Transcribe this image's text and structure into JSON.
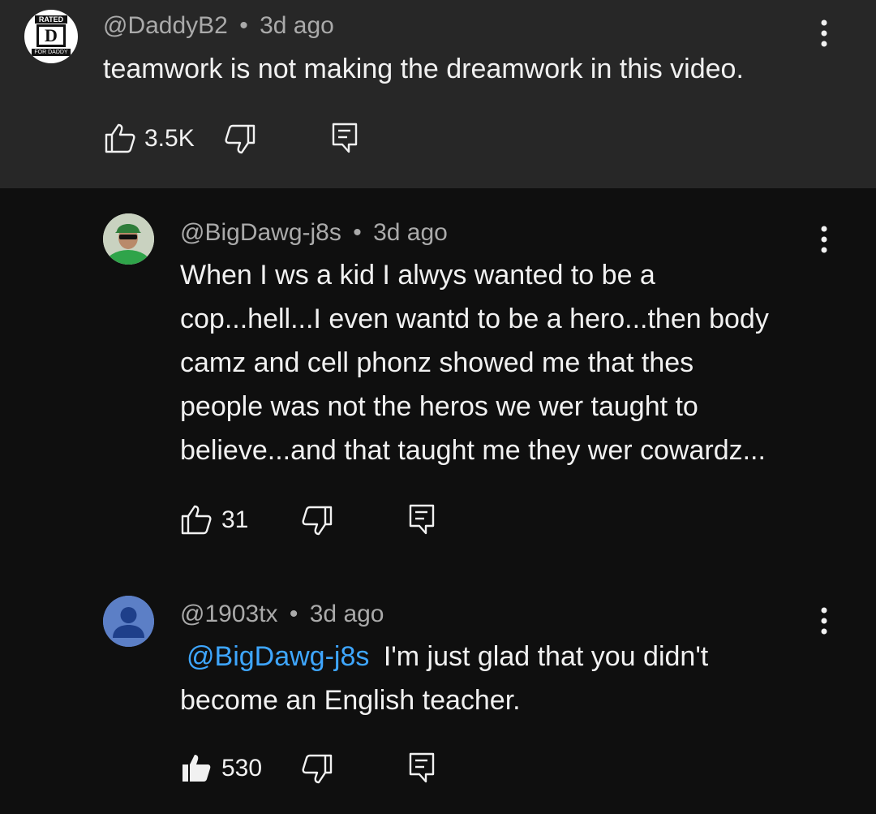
{
  "comments": [
    {
      "author": "@DaddyB2",
      "time": "3d ago",
      "text": "teamwork is not making the dreamwork in this video.",
      "likes": "3.5K",
      "liked": false,
      "avatar": {
        "label_top": "RATED",
        "label_mid": "D",
        "label_bottom": "FOR DADDY"
      }
    },
    {
      "author": "@BigDawg-j8s",
      "time": "3d ago",
      "lines": [
        "When I ws a kid I alwys wanted to be a",
        "cop...hell...I even wantd to be a hero...then body",
        "camz and cell phonz showed me that thes",
        "people was not the heros we wer taught to",
        "believe...and that taught me they wer cowardz..."
      ],
      "likes": "31",
      "liked": false
    },
    {
      "author": "@1903tx",
      "time": "3d ago",
      "mention": "@BigDawg-j8s",
      "line1_rest": " I'm just glad that you didn't",
      "line2": "become an English teacher.",
      "likes": "530",
      "liked": true
    }
  ],
  "separator": "•",
  "colors": {
    "top_bg": "#272727",
    "page_bg": "#0f0f0f",
    "mention": "#3ea6ff",
    "meta": "#aaaaaa"
  }
}
